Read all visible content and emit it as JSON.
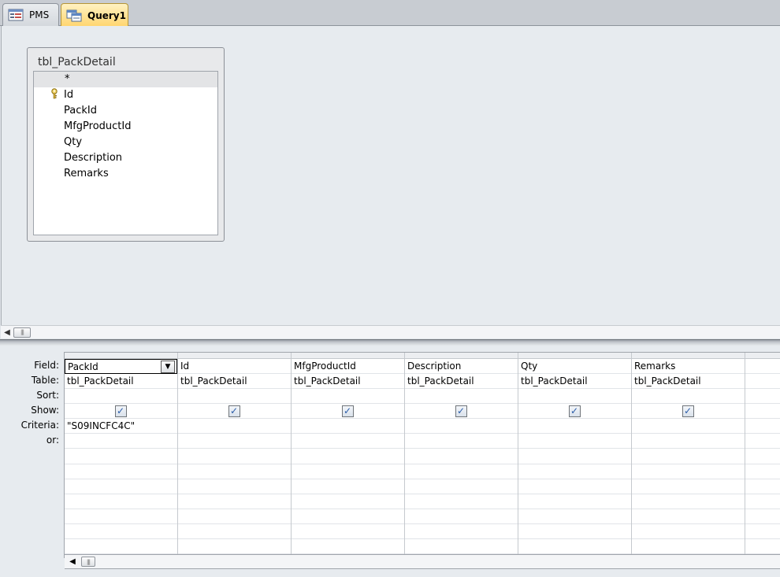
{
  "tabs": [
    {
      "label": "PMS",
      "icon": "form-icon",
      "active": false
    },
    {
      "label": "Query1",
      "icon": "query-icon",
      "active": true
    }
  ],
  "table_box": {
    "title": "tbl_PackDetail",
    "fields": [
      {
        "name": "*",
        "key": false
      },
      {
        "name": "Id",
        "key": true
      },
      {
        "name": "PackId",
        "key": false
      },
      {
        "name": "MfgProductId",
        "key": false
      },
      {
        "name": "Qty",
        "key": false
      },
      {
        "name": "Description",
        "key": false
      },
      {
        "name": "Remarks",
        "key": false
      }
    ]
  },
  "row_labels": [
    "Field:",
    "Table:",
    "Sort:",
    "Show:",
    "Criteria:",
    "or:"
  ],
  "columns": [
    {
      "field": "PackId",
      "table": "tbl_PackDetail",
      "sort": "",
      "show": true,
      "criteria": "\"S09INCFC4C\"",
      "or": "",
      "active": true
    },
    {
      "field": "Id",
      "table": "tbl_PackDetail",
      "sort": "",
      "show": true,
      "criteria": "",
      "or": ""
    },
    {
      "field": "MfgProductId",
      "table": "tbl_PackDetail",
      "sort": "",
      "show": true,
      "criteria": "",
      "or": ""
    },
    {
      "field": "Description",
      "table": "tbl_PackDetail",
      "sort": "",
      "show": true,
      "criteria": "",
      "or": ""
    },
    {
      "field": "Qty",
      "table": "tbl_PackDetail",
      "sort": "",
      "show": true,
      "criteria": "",
      "or": ""
    },
    {
      "field": "Remarks",
      "table": "tbl_PackDetail",
      "sort": "",
      "show": true,
      "criteria": "",
      "or": ""
    },
    {
      "field": "",
      "table": "",
      "sort": "",
      "show": false,
      "criteria": "",
      "or": ""
    }
  ],
  "glyphs": {
    "checkmark": "✓",
    "dropdown_arrow": "▼",
    "scroll_left": "◀",
    "thumb_grip": "|||"
  },
  "colors": {
    "active_tab": "#ffd56e",
    "check": "#2a5ca8"
  }
}
